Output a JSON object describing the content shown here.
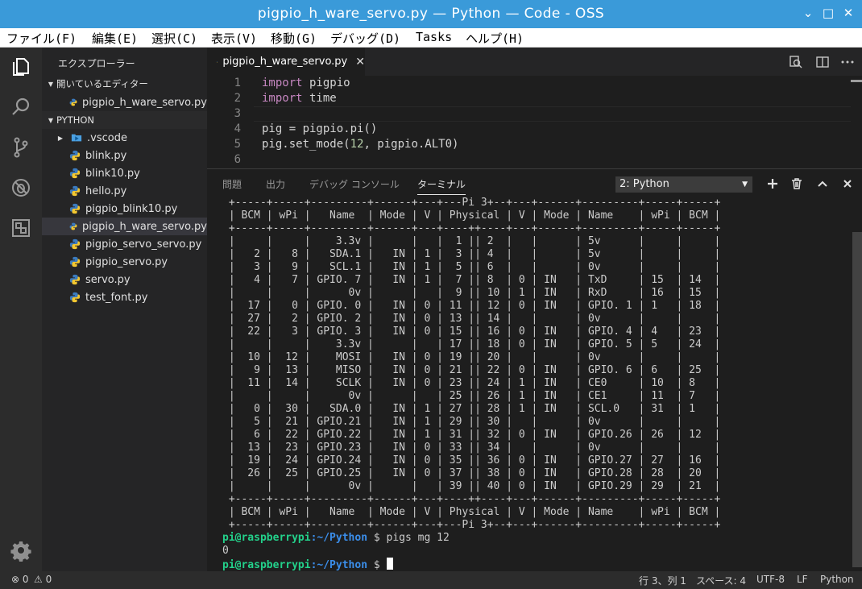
{
  "window": {
    "title": "pigpio_h_ware_servo.py — Python — Code - OSS",
    "minimize_glyph": "⌄",
    "maximize_glyph": "□",
    "close_glyph": "✕"
  },
  "menu": [
    "ファイル(F)",
    "編集(E)",
    "選択(C)",
    "表示(V)",
    "移動(G)",
    "デバッグ(D)",
    "Tasks",
    "ヘルプ(H)"
  ],
  "activity_bar": [
    "explorer-icon",
    "search-icon",
    "source-control-icon",
    "debug-icon",
    "extensions-icon",
    "gear-icon"
  ],
  "sidebar": {
    "title": "エクスプローラー",
    "open_editors_label": "開いているエディター",
    "open_editors": [
      "pigpio_h_ware_servo.py"
    ],
    "folder_label": "PYTHON",
    "files": [
      {
        "name": ".vscode",
        "type": "folder"
      },
      {
        "name": "blink.py",
        "type": "py"
      },
      {
        "name": "blink10.py",
        "type": "py"
      },
      {
        "name": "hello.py",
        "type": "py"
      },
      {
        "name": "pigpio_blink10.py",
        "type": "py"
      },
      {
        "name": "pigpio_h_ware_servo.py",
        "type": "py",
        "selected": true
      },
      {
        "name": "pigpio_servo_servo.py",
        "type": "py"
      },
      {
        "name": "pigpio_servo.py",
        "type": "py"
      },
      {
        "name": "servo.py",
        "type": "py"
      },
      {
        "name": "test_font.py",
        "type": "py"
      }
    ]
  },
  "editor": {
    "tab_label": "pigpio_h_ware_servo.py",
    "tab_close": "✕",
    "line_numbers": [
      "1",
      "2",
      "3",
      "4",
      "5",
      "6"
    ]
  },
  "panel": {
    "tabs": [
      "問題",
      "出力",
      "デバッグ コンソール",
      "ターミナル"
    ],
    "active_tab": "ターミナル",
    "terminal_select": "2: Python",
    "terminal_lines": [
      " +-----+-----+---------+------+---+---Pi 3+--+---+------+---------+-----+-----+",
      " | BCM | wPi |   Name  | Mode | V | Physical | V | Mode | Name    | wPi | BCM |",
      " +-----+-----+---------+------+---+----++----+---+------+---------+-----+-----+",
      " |     |     |    3.3v |      |   |  1 || 2  |   |      | 5v      |     |     |",
      " |   2 |   8 |   SDA.1 |   IN | 1 |  3 || 4  |   |      | 5v      |     |     |",
      " |   3 |   9 |   SCL.1 |   IN | 1 |  5 || 6  |   |      | 0v      |     |     |",
      " |   4 |   7 | GPIO. 7 |   IN | 1 |  7 || 8  | 0 | IN   | TxD     | 15  | 14  |",
      " |     |     |      0v |      |   |  9 || 10 | 1 | IN   | RxD     | 16  | 15  |",
      " |  17 |   0 | GPIO. 0 |   IN | 0 | 11 || 12 | 0 | IN   | GPIO. 1 | 1   | 18  |",
      " |  27 |   2 | GPIO. 2 |   IN | 0 | 13 || 14 |   |      | 0v      |     |     |",
      " |  22 |   3 | GPIO. 3 |   IN | 0 | 15 || 16 | 0 | IN   | GPIO. 4 | 4   | 23  |",
      " |     |     |    3.3v |      |   | 17 || 18 | 0 | IN   | GPIO. 5 | 5   | 24  |",
      " |  10 |  12 |    MOSI |   IN | 0 | 19 || 20 |   |      | 0v      |     |     |",
      " |   9 |  13 |    MISO |   IN | 0 | 21 || 22 | 0 | IN   | GPIO. 6 | 6   | 25  |",
      " |  11 |  14 |    SCLK |   IN | 0 | 23 || 24 | 1 | IN   | CE0     | 10  | 8   |",
      " |     |     |      0v |      |   | 25 || 26 | 1 | IN   | CE1     | 11  | 7   |",
      " |   0 |  30 |   SDA.0 |   IN | 1 | 27 || 28 | 1 | IN   | SCL.0   | 31  | 1   |",
      " |   5 |  21 | GPIO.21 |   IN | 1 | 29 || 30 |   |      | 0v      |     |     |",
      " |   6 |  22 | GPIO.22 |   IN | 1 | 31 || 32 | 0 | IN   | GPIO.26 | 26  | 12  |",
      " |  13 |  23 | GPIO.23 |   IN | 0 | 33 || 34 |   |      | 0v      |     |     |",
      " |  19 |  24 | GPIO.24 |   IN | 0 | 35 || 36 | 0 | IN   | GPIO.27 | 27  | 16  |",
      " |  26 |  25 | GPIO.25 |   IN | 0 | 37 || 38 | 0 | IN   | GPIO.28 | 28  | 20  |",
      " |     |     |      0v |      |   | 39 || 40 | 0 | IN   | GPIO.29 | 29  | 21  |",
      " +-----+-----+---------+------+---+----++----+---+------+---------+-----+-----+",
      " | BCM | wPi |   Name  | Mode | V | Physical | V | Mode | Name    | wPi | BCM |",
      " +-----+-----+---------+------+---+---Pi 3+--+---+------+---------+-----+-----+"
    ],
    "prompt_user": "pi@raspberrypi",
    "prompt_path": ":~/Python",
    "prompt_symbol": " $ ",
    "command": "pigs mg 12",
    "command_output": "0"
  },
  "statusbar": {
    "errors": "0",
    "warnings": "0",
    "position": "行 3、列 1",
    "spaces": "スペース: 4",
    "encoding": "UTF-8",
    "eol": "LF",
    "language": "Python"
  }
}
